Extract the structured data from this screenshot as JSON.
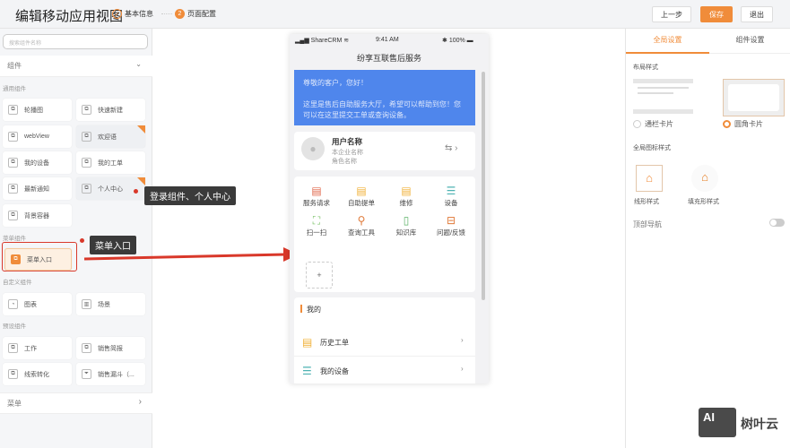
{
  "header": {
    "title": "编辑移动应用视图",
    "steps": [
      {
        "num": "✓",
        "label": "基本信息"
      },
      {
        "num": "2",
        "label": "页面配置"
      }
    ],
    "prev_label": "上一步",
    "save_label": "保存",
    "exit_label": "退出"
  },
  "left": {
    "search_placeholder": "搜索组件名称",
    "components_label": "组件",
    "groups": [
      {
        "title": "通用组件",
        "items": [
          "轮播图",
          "快速新建",
          "webView",
          "欢迎语",
          "我的设备",
          "我的工单",
          "最新通知",
          "个人中心",
          "背景容器"
        ]
      },
      {
        "title": "菜单组件",
        "items": [
          "菜单入口"
        ]
      },
      {
        "title": "自定义组件",
        "items": [
          "图表",
          "场景"
        ]
      },
      {
        "title": "预设组件",
        "items": [
          "工作",
          "销售简报",
          "线索转化",
          "销售漏斗（..."
        ]
      }
    ],
    "menu_label": "菜单"
  },
  "annotations": {
    "tip1": "登录组件、个人中心",
    "tip2": "菜单入口"
  },
  "phone": {
    "carrier": "ShareCRM",
    "time": "9:41 AM",
    "battery": "100%",
    "title": "纷享互联售后服务",
    "banner": {
      "greeting": "尊敬的客户，您好！",
      "text": "这里是售后自助服务大厅，希望可以帮助到您！您可以在这里提交工单或查询设备。"
    },
    "user": {
      "name": "用户名称",
      "company": "本企业名称",
      "role": "角色名称"
    },
    "grid": [
      "服务请求",
      "自助提单",
      "维修",
      "设备",
      "扫一扫",
      "查询工具",
      "知识库",
      "问题/反馈"
    ],
    "add": "+",
    "mine": {
      "title": "我的",
      "items": [
        "历史工单",
        "我的设备"
      ]
    }
  },
  "right": {
    "tabs": [
      "全局设置",
      "组件设置"
    ],
    "layout_label": "布局样式",
    "layout_options": [
      "通栏卡片",
      "圆角卡片"
    ],
    "icon_label": "全局图标样式",
    "icon_options": [
      "线形样式",
      "填充形样式"
    ],
    "topnav_label": "顶部导航",
    "topnav_on": false
  },
  "watermark": {
    "logo": "AI",
    "text": "树叶云"
  },
  "colors": {
    "accent": "#f08c3a",
    "annotation": "#d9382a",
    "banner": "#4f86ec"
  }
}
